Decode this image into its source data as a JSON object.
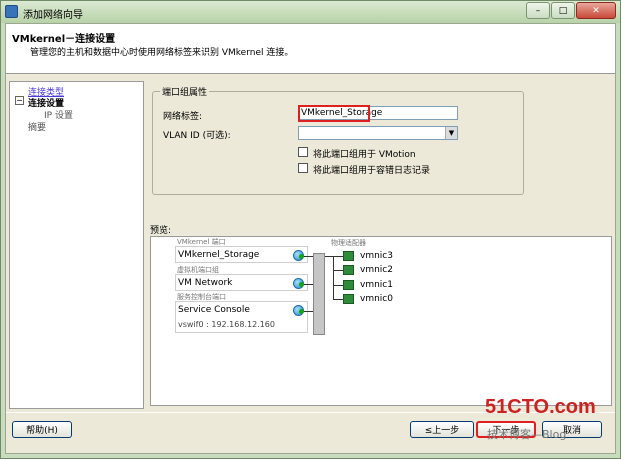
{
  "window": {
    "title": "添加网络向导",
    "min": "–",
    "max": "□",
    "close": "✕"
  },
  "header": {
    "title": "VMkernel－连接设置",
    "description": "管理您的主机和数据中心时使用网络标签来识别 VMkernel 连接。"
  },
  "nav": {
    "connection_type": "连接类型",
    "expand": "−",
    "connection_settings": "连接设置",
    "ip_settings": "IP 设置",
    "summary": "摘要"
  },
  "port_group": {
    "title": "端口组属性",
    "network_label": "网络标签:",
    "network_value": "VMkernel_Storage",
    "vlan_label": "VLAN ID (可选):",
    "vlan_value": "",
    "vmotion_checkbox": "将此端口组用于 VMotion",
    "log_checkbox": "将此端口组用于容错日志记录"
  },
  "preview": {
    "label": "预览:",
    "vmkernel_port_label": "VMkernel 端口",
    "vmkernel_port_name": "VMkernel_Storage",
    "vm_portgroup_label": "虚拟机端口组",
    "vm_portgroup_name": "VM Network",
    "console_port_label": "服务控制台端口",
    "console_port_name": "Service Console",
    "console_ip": "vswif0 : 192.168.12.160",
    "adapters_label": "物理适配器",
    "adapters": [
      "vmnic3",
      "vmnic2",
      "vmnic1",
      "vmnic0"
    ]
  },
  "footer": {
    "help": "帮助(H)",
    "back": "≤上一步",
    "next": "下一步",
    "cancel": "取消"
  },
  "watermark": {
    "main": "51CTO.com",
    "sub": "技术博客—Blog"
  }
}
